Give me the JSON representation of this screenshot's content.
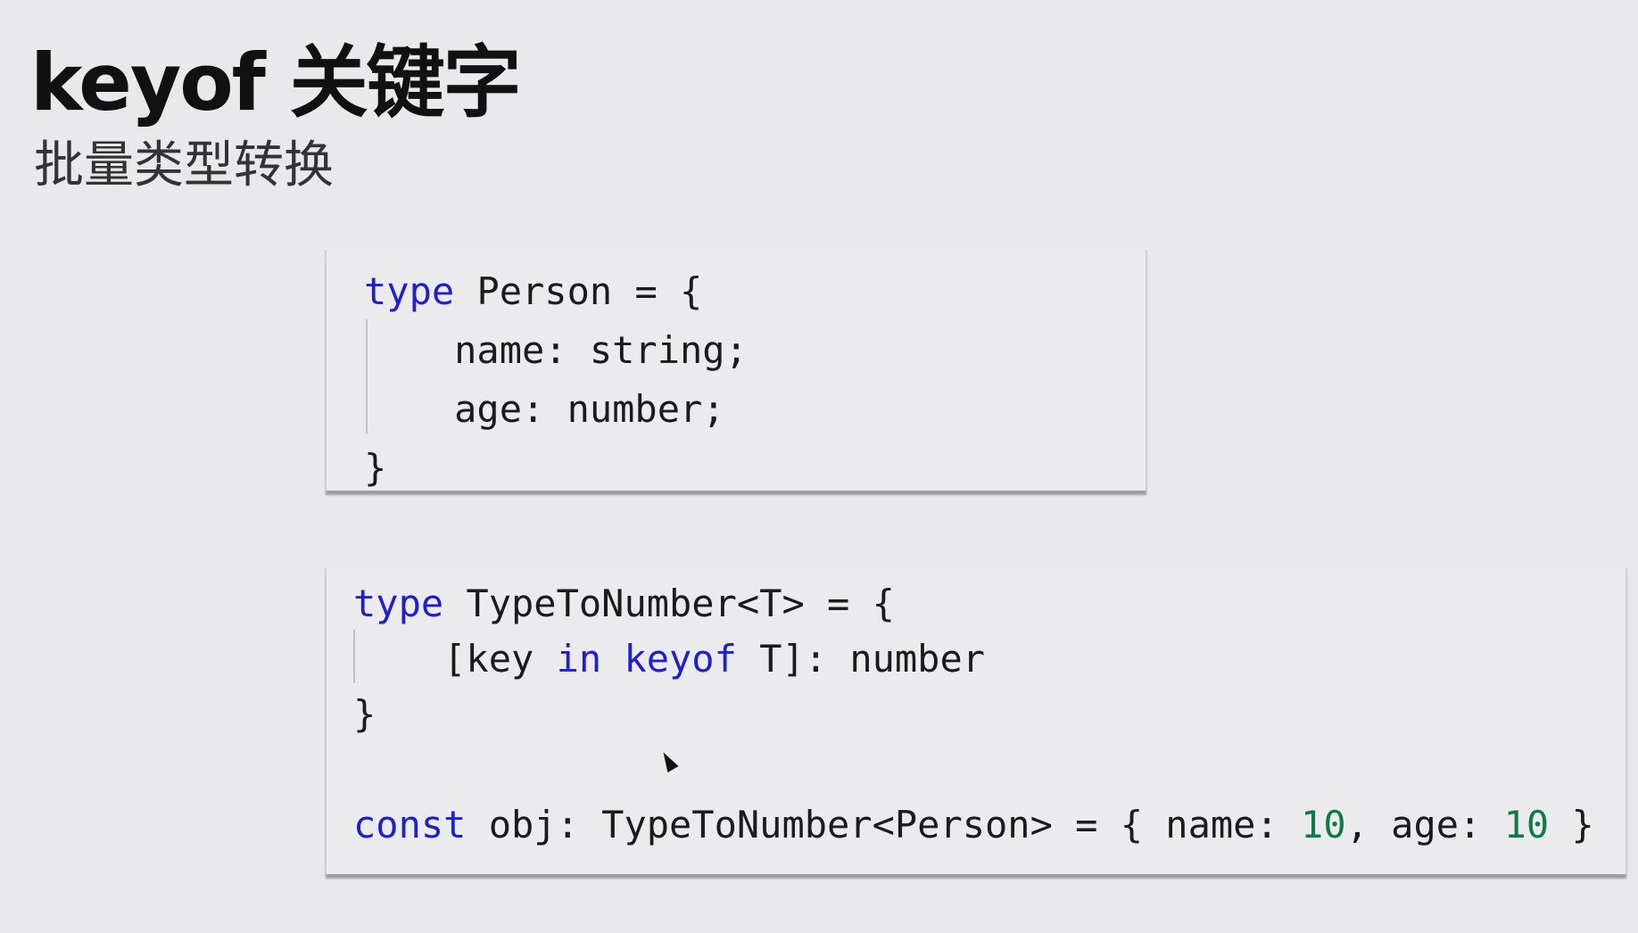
{
  "slide": {
    "title": "keyof 关键字",
    "subtitle": "批量类型转换"
  },
  "code_block_1": {
    "line1": {
      "kw": "type",
      "rest": " Person = {"
    },
    "line2": "    name: string;",
    "line3": "    age: number;",
    "line4": "}"
  },
  "code_block_2": {
    "line1": {
      "kw": "type",
      "rest": " TypeToNumber<T> = {"
    },
    "line2": {
      "pre": "    [key ",
      "kw_in": "in",
      "sp": " ",
      "kw_keyof": "keyof",
      "post": " T]: number"
    },
    "line3": "}",
    "line5": {
      "kw": "const",
      "a": " obj: TypeToNumber<Person> = { name: ",
      "n1": "10",
      "b": ", age: ",
      "n2": "10",
      "c": " }"
    }
  },
  "colors": {
    "keyword": "#1f20c9",
    "number": "#127a4a",
    "background": "#e9e8ea"
  },
  "icons": [
    "mouse-cursor-icon"
  ]
}
